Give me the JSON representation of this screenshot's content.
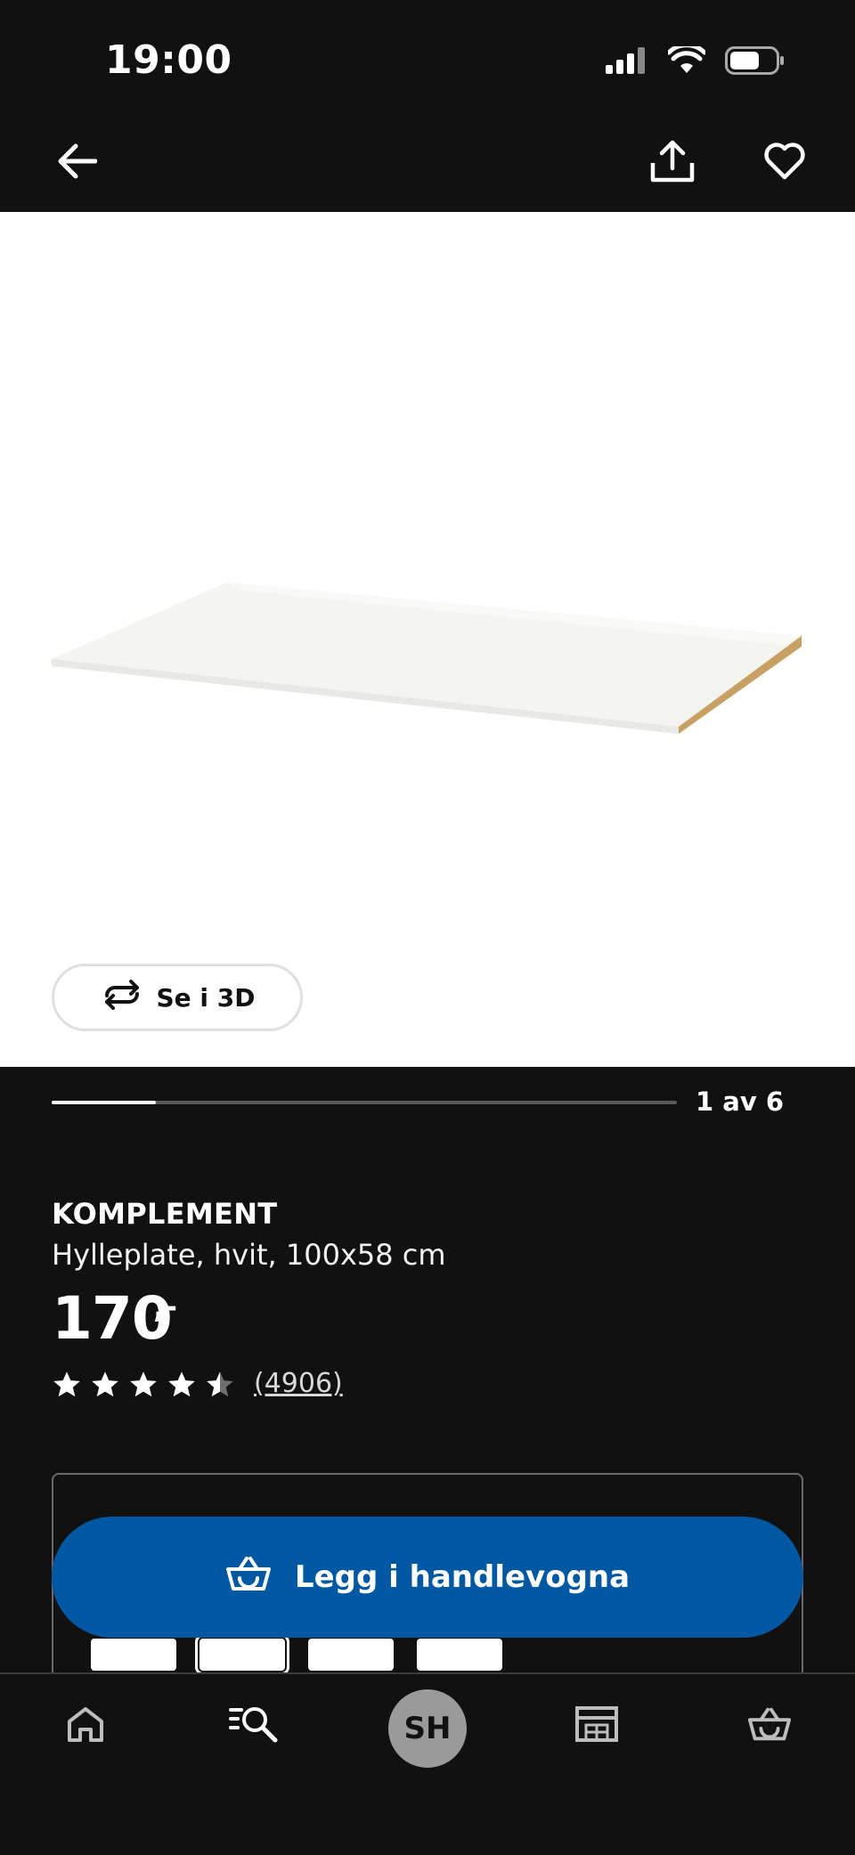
{
  "status_bar": {
    "time": "19:00",
    "icons": [
      "signal-icon",
      "wifi-icon",
      "battery-icon"
    ]
  },
  "top_nav": {
    "icons": [
      "back-arrow-icon",
      "share-icon",
      "heart-icon"
    ]
  },
  "gallery": {
    "view_3d_label": "Se i 3D",
    "page_indicator": "1 av 6",
    "current_page": 1,
    "total_pages": 6
  },
  "product": {
    "brand": "KOMPLEMENT",
    "description": "Hylleplate, hvit, 100x58 cm",
    "price": "170",
    "price_suffix": ",-",
    "rating": 4.5,
    "rating_max": 5,
    "review_count": "(4906)"
  },
  "cta": {
    "add_to_cart_label": "Legg i handlevogna"
  },
  "bottom_nav": {
    "avatar_initials": "SH",
    "items": [
      "home-icon",
      "search-icon",
      "avatar",
      "store-icon",
      "cart-icon"
    ]
  },
  "colors": {
    "background": "#111111",
    "accent_blue": "#0058a3",
    "image_background": "#ffffff"
  }
}
